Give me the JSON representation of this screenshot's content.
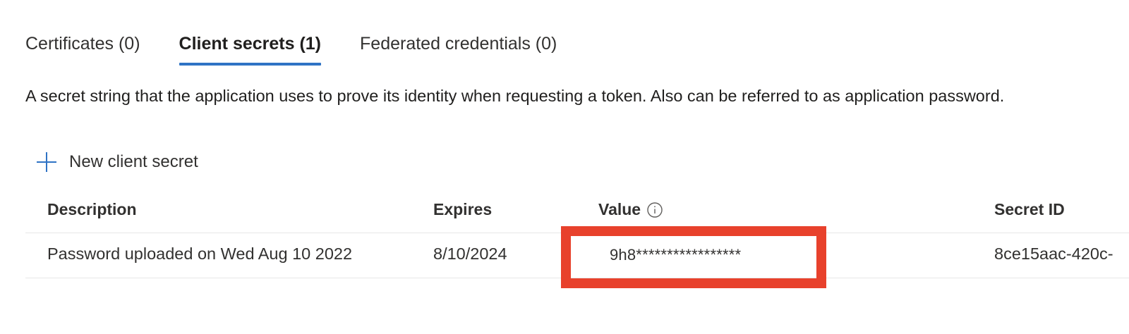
{
  "tabs": [
    {
      "label": "Certificates (0)",
      "active": false
    },
    {
      "label": "Client secrets (1)",
      "active": true
    },
    {
      "label": "Federated credentials (0)",
      "active": false
    }
  ],
  "description": "A secret string that the application uses to prove its identity when requesting a token. Also can be referred to as application password.",
  "commands": {
    "new_secret_label": "New client secret",
    "new_secret_icon": "plus-icon"
  },
  "table": {
    "headers": {
      "description": "Description",
      "expires": "Expires",
      "value": "Value",
      "value_icon": "info-icon",
      "secret_id": "Secret ID"
    },
    "rows": [
      {
        "description": "Password uploaded on Wed Aug 10 2022",
        "expires": "8/10/2024",
        "value": "9h8*****************",
        "secret_id": "8ce15aac-420c-"
      }
    ]
  },
  "colors": {
    "accent": "#2f73c5",
    "highlight": "#e8412c"
  }
}
